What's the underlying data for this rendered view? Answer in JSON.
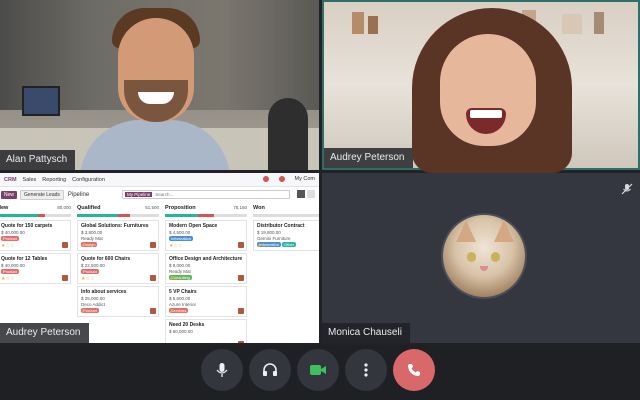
{
  "participants": [
    {
      "id": "alan",
      "name": "Alan Pattysch"
    },
    {
      "id": "audrey_cam",
      "name": "Audrey Peterson"
    },
    {
      "id": "audrey_share",
      "name": "Audrey Peterson"
    },
    {
      "id": "monica",
      "name": "Monica Chauseli"
    }
  ],
  "crm": {
    "app_name": "CRM",
    "nav": [
      "Sales",
      "Reporting",
      "Configuration"
    ],
    "company": "My Com",
    "new_label": "New",
    "generate_label": "Generate Leads",
    "page_title": "Pipeline",
    "filter_tag": "My Pipeline",
    "search_placeholder": "Search...",
    "columns": [
      {
        "title": "New",
        "amount": "80,000",
        "won_fraction": 0.55,
        "lost_fraction": 0.1,
        "cards": [
          {
            "title": "Quote for 150 carpets",
            "value": "$ 40,000.00",
            "tag": "Product",
            "tag_color": "red",
            "stars": "★☆☆"
          },
          {
            "title": "Quote for 12 Tables",
            "value": "$ 40,000.00",
            "tag": "Product",
            "tag_color": "red",
            "stars": "★☆☆"
          }
        ]
      },
      {
        "title": "Qualified",
        "amount": "51,500",
        "won_fraction": 0.5,
        "lost_fraction": 0.15,
        "cards": [
          {
            "title": "Global Solutions: Furnitures",
            "value": "$ 3,800.00",
            "sub": "Ready Mat",
            "tag": "Design",
            "tag_color": "red",
            "stars": "★★☆"
          },
          {
            "title": "Quote for 600 Chairs",
            "value": "$ 22,500.00",
            "tag": "Product",
            "tag_color": "red",
            "stars": "★☆☆"
          },
          {
            "title": "Info about services",
            "value": "$ 25,000.00",
            "sub": "Deco Addict",
            "tag": "Product",
            "tag_color": "red",
            "stars": "★☆☆"
          }
        ]
      },
      {
        "title": "Proposition",
        "amount": "78,150",
        "won_fraction": 0.4,
        "lost_fraction": 0.2,
        "cards": [
          {
            "title": "Modern Open Space",
            "value": "$ 4,500.00",
            "tag": "Information",
            "tag_color": "blue",
            "stars": "★☆☆"
          },
          {
            "title": "Office Design and Architecture",
            "value": "$ 9,000.00",
            "sub": "Ready Mat",
            "tag": "Consulting",
            "tag_color": "green",
            "stars": "★★☆"
          },
          {
            "title": "5 VP Chairs",
            "value": "$ 5,600.00",
            "sub": "Azure Interior",
            "tag": "Services",
            "tag_color": "red",
            "stars": "★☆☆"
          },
          {
            "title": "Need 20 Desks",
            "value": "$ 60,000.00",
            "tag": "",
            "tag_color": "red",
            "stars": ""
          }
        ]
      },
      {
        "title": "Won",
        "amount": "",
        "won_fraction": 0.0,
        "lost_fraction": 0.0,
        "cards": [
          {
            "title": "Distributor Contract",
            "value": "$ 19,800.00",
            "sub": "Gemini Furniture",
            "tag": "Information",
            "tag2": "Other",
            "tag_color": "blue",
            "stars": "★★☆"
          }
        ]
      }
    ]
  },
  "controls": [
    {
      "id": "mic",
      "icon": "microphone-icon",
      "glyph": "🎙"
    },
    {
      "id": "audio",
      "icon": "headphones-icon",
      "glyph": "🎧"
    },
    {
      "id": "camera",
      "icon": "video-camera-icon",
      "glyph": "■"
    },
    {
      "id": "more",
      "icon": "more-options-icon",
      "glyph": "⋮"
    },
    {
      "id": "hangup",
      "icon": "phone-hangup-icon",
      "glyph": "✆"
    }
  ],
  "colors": {
    "accent": "#2f6f6a",
    "hangup": "#d9686a",
    "crm_brand": "#7b3f69",
    "camera_on": "#3fbf5e"
  },
  "monica_status_icon": "microphone-muted-icon"
}
